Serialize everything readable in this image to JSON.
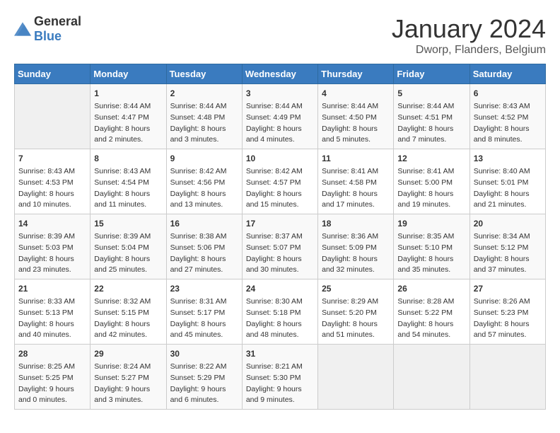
{
  "logo": {
    "text_general": "General",
    "text_blue": "Blue"
  },
  "title": "January 2024",
  "location": "Dworp, Flanders, Belgium",
  "days_of_week": [
    "Sunday",
    "Monday",
    "Tuesday",
    "Wednesday",
    "Thursday",
    "Friday",
    "Saturday"
  ],
  "weeks": [
    [
      {
        "day": "",
        "sunrise": "",
        "sunset": "",
        "daylight": "",
        "empty": true
      },
      {
        "day": "1",
        "sunrise": "8:44 AM",
        "sunset": "4:47 PM",
        "daylight": "8 hours and 2 minutes."
      },
      {
        "day": "2",
        "sunrise": "8:44 AM",
        "sunset": "4:48 PM",
        "daylight": "8 hours and 3 minutes."
      },
      {
        "day": "3",
        "sunrise": "8:44 AM",
        "sunset": "4:49 PM",
        "daylight": "8 hours and 4 minutes."
      },
      {
        "day": "4",
        "sunrise": "8:44 AM",
        "sunset": "4:50 PM",
        "daylight": "8 hours and 5 minutes."
      },
      {
        "day": "5",
        "sunrise": "8:44 AM",
        "sunset": "4:51 PM",
        "daylight": "8 hours and 7 minutes."
      },
      {
        "day": "6",
        "sunrise": "8:43 AM",
        "sunset": "4:52 PM",
        "daylight": "8 hours and 8 minutes."
      }
    ],
    [
      {
        "day": "7",
        "sunrise": "8:43 AM",
        "sunset": "4:53 PM",
        "daylight": "8 hours and 10 minutes."
      },
      {
        "day": "8",
        "sunrise": "8:43 AM",
        "sunset": "4:54 PM",
        "daylight": "8 hours and 11 minutes."
      },
      {
        "day": "9",
        "sunrise": "8:42 AM",
        "sunset": "4:56 PM",
        "daylight": "8 hours and 13 minutes."
      },
      {
        "day": "10",
        "sunrise": "8:42 AM",
        "sunset": "4:57 PM",
        "daylight": "8 hours and 15 minutes."
      },
      {
        "day": "11",
        "sunrise": "8:41 AM",
        "sunset": "4:58 PM",
        "daylight": "8 hours and 17 minutes."
      },
      {
        "day": "12",
        "sunrise": "8:41 AM",
        "sunset": "5:00 PM",
        "daylight": "8 hours and 19 minutes."
      },
      {
        "day": "13",
        "sunrise": "8:40 AM",
        "sunset": "5:01 PM",
        "daylight": "8 hours and 21 minutes."
      }
    ],
    [
      {
        "day": "14",
        "sunrise": "8:39 AM",
        "sunset": "5:03 PM",
        "daylight": "8 hours and 23 minutes."
      },
      {
        "day": "15",
        "sunrise": "8:39 AM",
        "sunset": "5:04 PM",
        "daylight": "8 hours and 25 minutes."
      },
      {
        "day": "16",
        "sunrise": "8:38 AM",
        "sunset": "5:06 PM",
        "daylight": "8 hours and 27 minutes."
      },
      {
        "day": "17",
        "sunrise": "8:37 AM",
        "sunset": "5:07 PM",
        "daylight": "8 hours and 30 minutes."
      },
      {
        "day": "18",
        "sunrise": "8:36 AM",
        "sunset": "5:09 PM",
        "daylight": "8 hours and 32 minutes."
      },
      {
        "day": "19",
        "sunrise": "8:35 AM",
        "sunset": "5:10 PM",
        "daylight": "8 hours and 35 minutes."
      },
      {
        "day": "20",
        "sunrise": "8:34 AM",
        "sunset": "5:12 PM",
        "daylight": "8 hours and 37 minutes."
      }
    ],
    [
      {
        "day": "21",
        "sunrise": "8:33 AM",
        "sunset": "5:13 PM",
        "daylight": "8 hours and 40 minutes."
      },
      {
        "day": "22",
        "sunrise": "8:32 AM",
        "sunset": "5:15 PM",
        "daylight": "8 hours and 42 minutes."
      },
      {
        "day": "23",
        "sunrise": "8:31 AM",
        "sunset": "5:17 PM",
        "daylight": "8 hours and 45 minutes."
      },
      {
        "day": "24",
        "sunrise": "8:30 AM",
        "sunset": "5:18 PM",
        "daylight": "8 hours and 48 minutes."
      },
      {
        "day": "25",
        "sunrise": "8:29 AM",
        "sunset": "5:20 PM",
        "daylight": "8 hours and 51 minutes."
      },
      {
        "day": "26",
        "sunrise": "8:28 AM",
        "sunset": "5:22 PM",
        "daylight": "8 hours and 54 minutes."
      },
      {
        "day": "27",
        "sunrise": "8:26 AM",
        "sunset": "5:23 PM",
        "daylight": "8 hours and 57 minutes."
      }
    ],
    [
      {
        "day": "28",
        "sunrise": "8:25 AM",
        "sunset": "5:25 PM",
        "daylight": "9 hours and 0 minutes."
      },
      {
        "day": "29",
        "sunrise": "8:24 AM",
        "sunset": "5:27 PM",
        "daylight": "9 hours and 3 minutes."
      },
      {
        "day": "30",
        "sunrise": "8:22 AM",
        "sunset": "5:29 PM",
        "daylight": "9 hours and 6 minutes."
      },
      {
        "day": "31",
        "sunrise": "8:21 AM",
        "sunset": "5:30 PM",
        "daylight": "9 hours and 9 minutes."
      },
      {
        "day": "",
        "sunrise": "",
        "sunset": "",
        "daylight": "",
        "empty": true
      },
      {
        "day": "",
        "sunrise": "",
        "sunset": "",
        "daylight": "",
        "empty": true
      },
      {
        "day": "",
        "sunrise": "",
        "sunset": "",
        "daylight": "",
        "empty": true
      }
    ]
  ]
}
